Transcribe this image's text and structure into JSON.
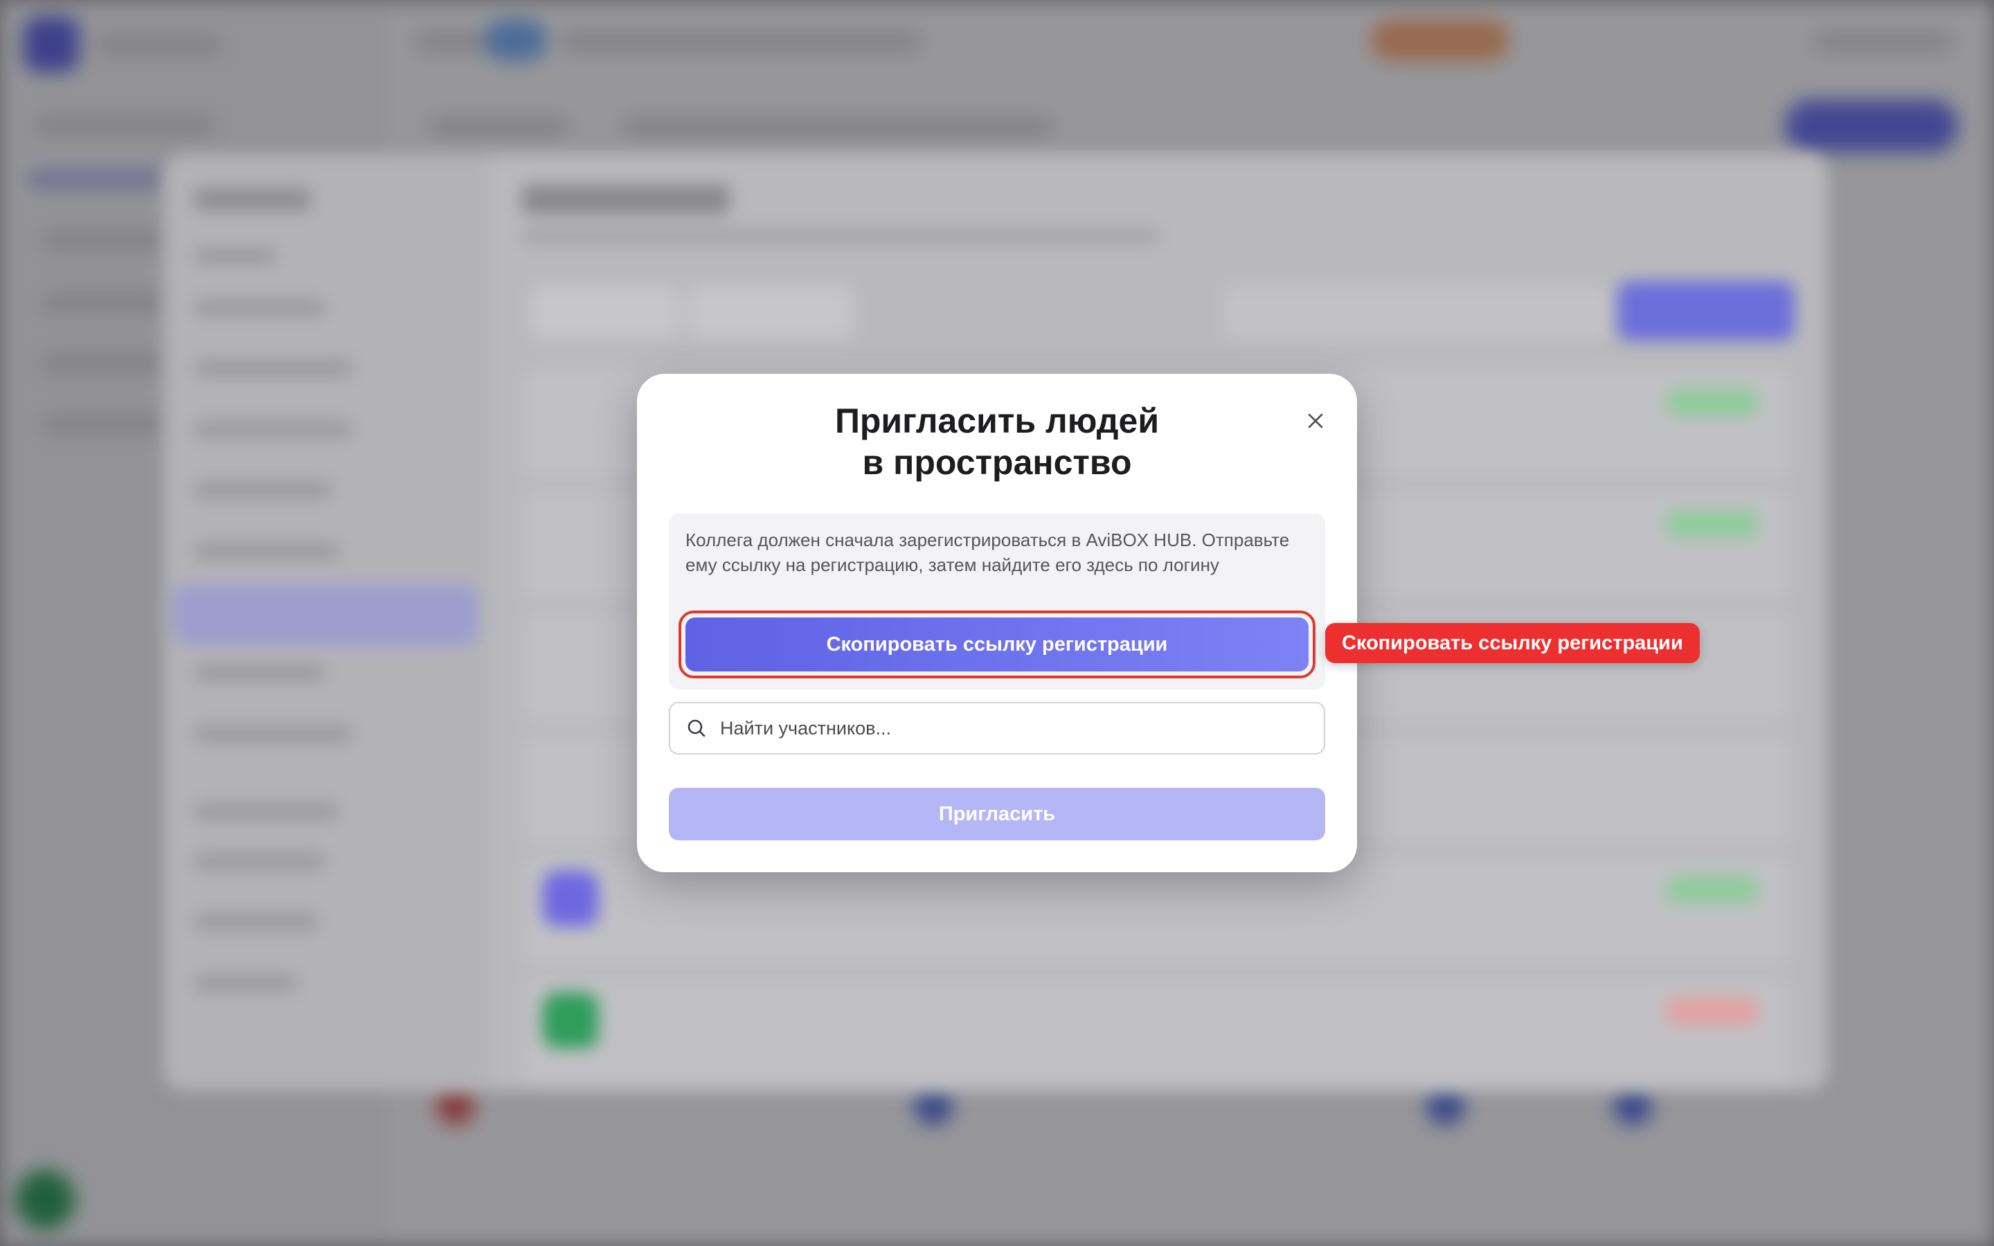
{
  "modal": {
    "title": "Пригласить людей\nв пространство",
    "info_text": "Коллега должен сначала зарегистрироваться в AviBOX HUB. Отправьте ему ссылку на регистрацию, затем найдите его здесь по логину",
    "copy_link_label": "Скопировать ссылку регистрации",
    "search": {
      "placeholder": "Найти участников...",
      "value": ""
    },
    "invite_label": "Пригласить",
    "close_icon": "close-icon"
  },
  "annotation": {
    "tooltip_text": "Скопировать ссылку регистрации"
  },
  "colors": {
    "primary": "#6366f1",
    "primary_disabled": "#b4b6f6",
    "highlight": "#ee2f2f"
  },
  "icons": [
    "close-icon",
    "search-icon"
  ]
}
